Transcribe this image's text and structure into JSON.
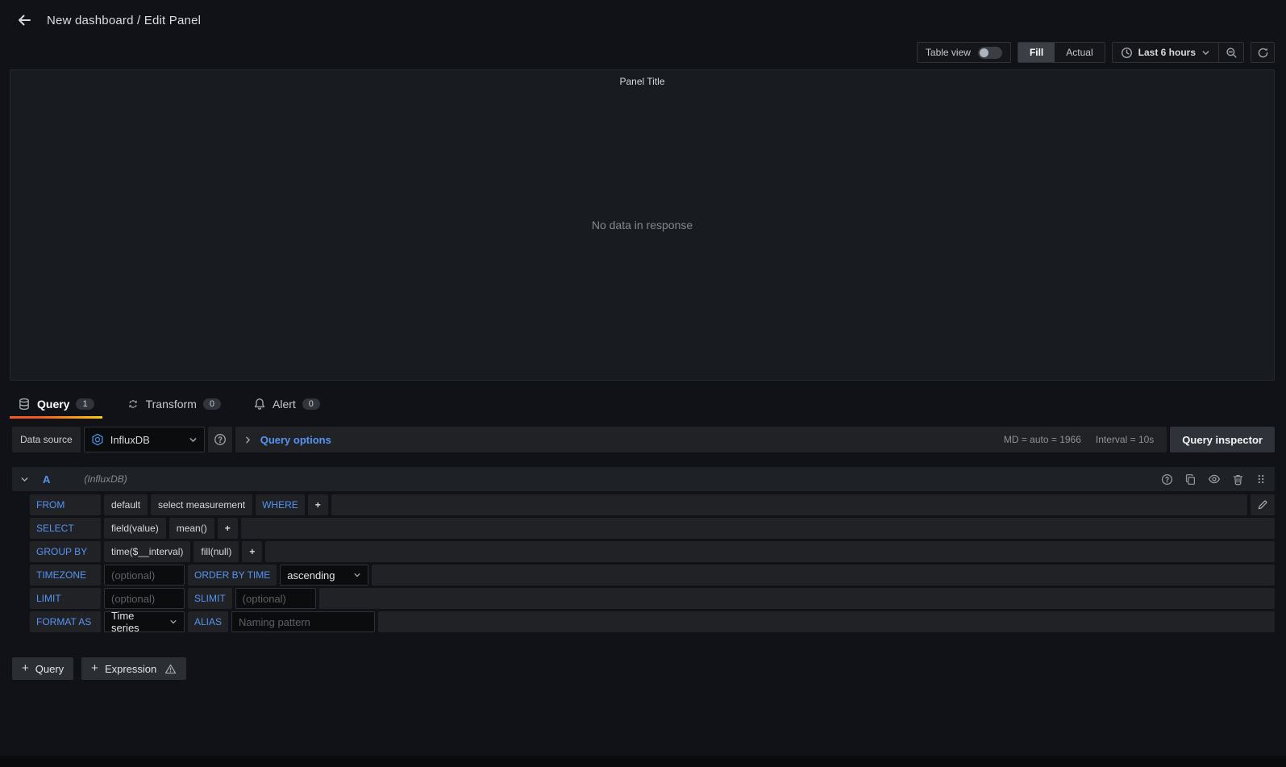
{
  "header": {
    "title": "New dashboard / Edit Panel"
  },
  "toolbar": {
    "table_view_label": "Table view",
    "fill_label": "Fill",
    "actual_label": "Actual",
    "time_range_label": "Last 6 hours"
  },
  "panel": {
    "title": "Panel Title",
    "message": "No data in response"
  },
  "tabs": [
    {
      "label": "Query",
      "count": "1"
    },
    {
      "label": "Transform",
      "count": "0"
    },
    {
      "label": "Alert",
      "count": "0"
    }
  ],
  "datasource_bar": {
    "label": "Data source",
    "selected": "InfluxDB",
    "query_options_label": "Query options",
    "md_info": "MD = auto = 1966",
    "interval_info": "Interval = 10s",
    "inspector_label": "Query inspector"
  },
  "query_editor": {
    "ref_id": "A",
    "datasource_hint": "(InfluxDB)",
    "plus_label": "+",
    "from": {
      "label": "FROM",
      "policy": "default",
      "measurement": "select measurement",
      "where_label": "WHERE"
    },
    "select": {
      "label": "SELECT",
      "field": "field(value)",
      "func": "mean()"
    },
    "group_by": {
      "label": "GROUP BY",
      "time": "time($__interval)",
      "fill": "fill(null)"
    },
    "timezone": {
      "label": "TIMEZONE",
      "placeholder": "(optional)",
      "order_label": "ORDER BY TIME",
      "order_value": "ascending"
    },
    "limit": {
      "label": "LIMIT",
      "placeholder": "(optional)",
      "slimit_label": "SLIMIT",
      "slimit_placeholder": "(optional)"
    },
    "format": {
      "label": "FORMAT AS",
      "value": "Time series",
      "alias_label": "ALIAS",
      "alias_placeholder": "Naming pattern"
    }
  },
  "footer": {
    "add_query_label": "Query",
    "add_expression_label": "Expression"
  },
  "colors": {
    "accent_blue": "#5794f2",
    "tab_gradient_start": "#f05a28",
    "tab_gradient_end": "#fbca0a",
    "background": "#111217",
    "panel_background": "#181b1f",
    "cell_background": "#202226"
  }
}
